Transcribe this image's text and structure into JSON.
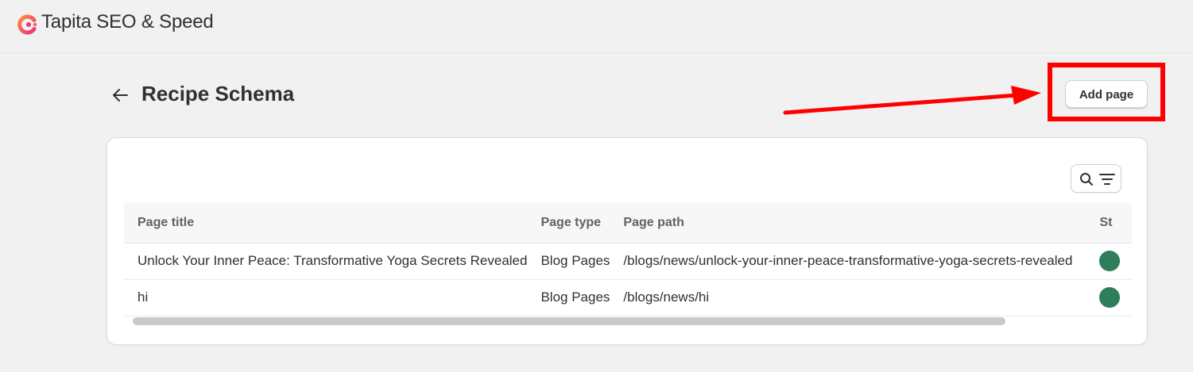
{
  "app": {
    "title": "Tapita SEO & Speed"
  },
  "page": {
    "title": "Recipe Schema",
    "add_button_label": "Add page"
  },
  "table": {
    "columns": [
      "Page title",
      "Page type",
      "Page path",
      "St"
    ],
    "rows": [
      {
        "title": "Unlock Your Inner Peace: Transformative Yoga Secrets Revealed",
        "type": "Blog Pages",
        "path": "/blogs/news/unlock-your-inner-peace-transformative-yoga-secrets-revealed"
      },
      {
        "title": "hi",
        "type": "Blog Pages",
        "path": "/blogs/news/hi"
      }
    ]
  },
  "icons": {
    "logo": "tapita-logo-icon",
    "back": "arrow-left-icon",
    "search": "search-icon",
    "filter": "filter-icon",
    "status": "status-dot-icon"
  },
  "colors": {
    "annotation": "#ff0000",
    "status_active": "#2e7d5b",
    "logo_pink": "#f0347a",
    "logo_orange": "#ff8a3d"
  }
}
